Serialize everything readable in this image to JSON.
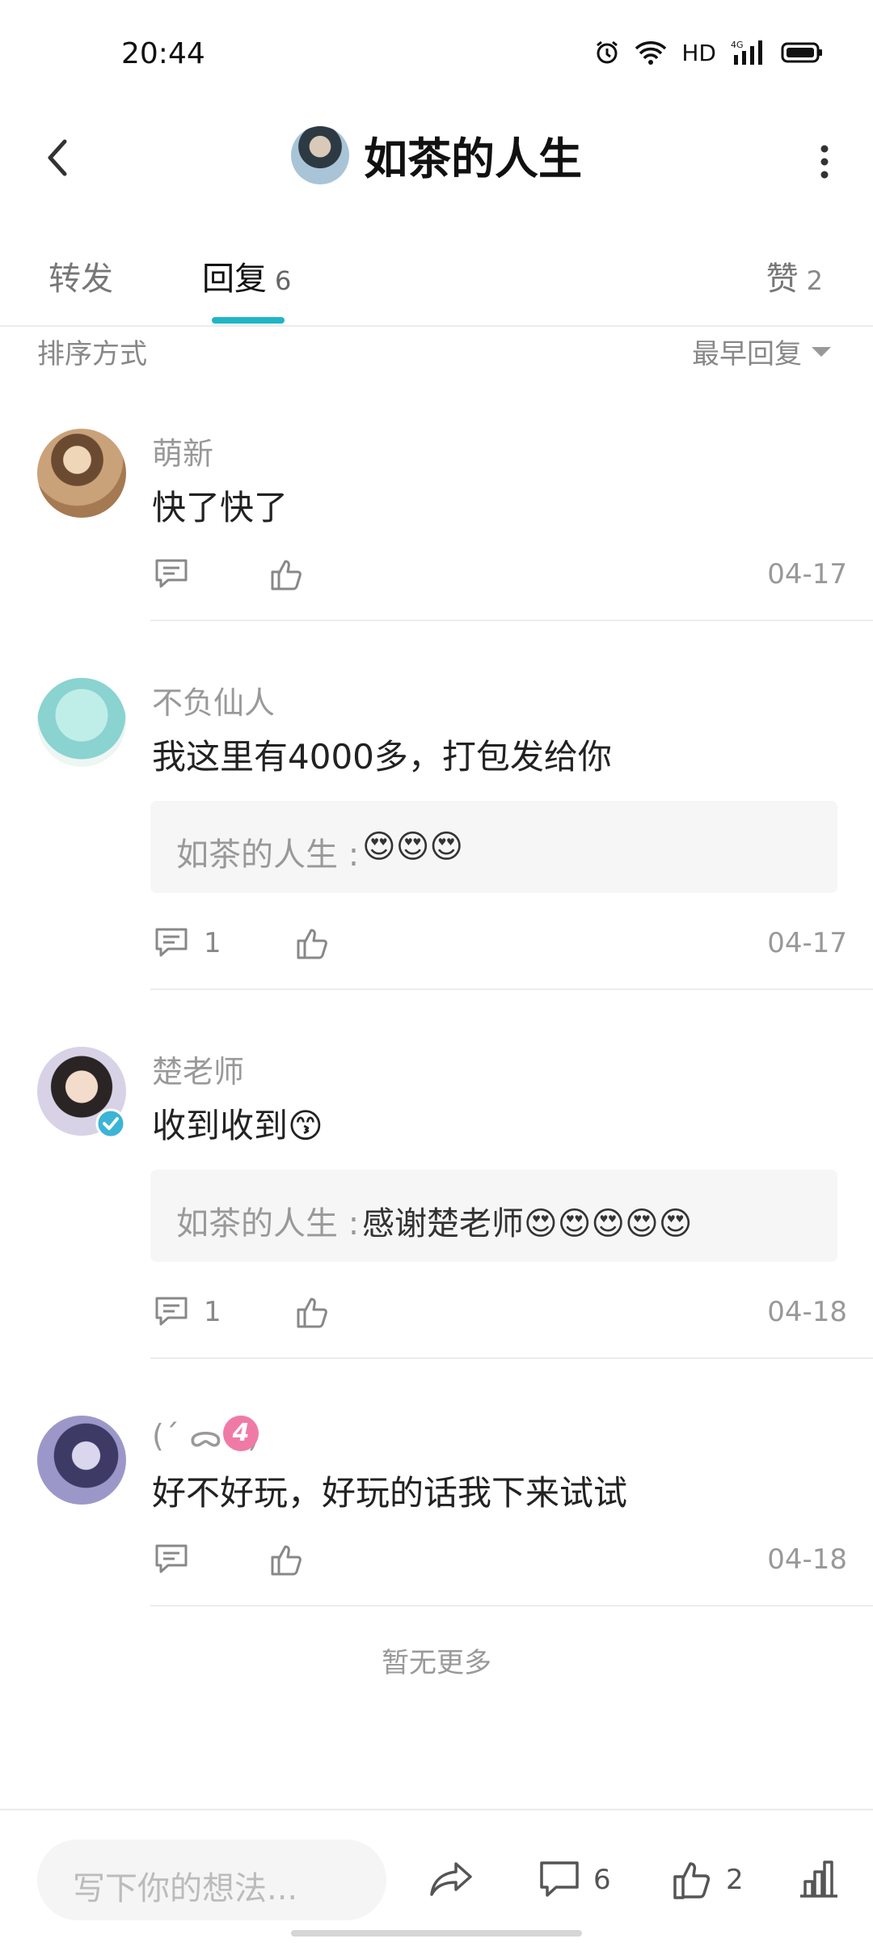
{
  "status_bar": {
    "time": "20:44",
    "network": "HD",
    "signal_label": "4G"
  },
  "nav": {
    "title": "如茶的人生",
    "back_icon": "chevron-left-icon",
    "more_icon": "more-vertical-icon"
  },
  "tabs": {
    "forward_label": "转发",
    "reply_label": "回复",
    "reply_count": "6",
    "like_label": "赞",
    "like_count": "2",
    "active": "回复",
    "accent_color": "#1fb5c5"
  },
  "sort": {
    "label": "排序方式",
    "selected": "最早回复"
  },
  "comments": [
    {
      "user": "萌新",
      "text": "快了快了",
      "reply_count": "",
      "date": "04-17",
      "quote": null
    },
    {
      "user": "不负仙人",
      "text": "我这里有4000多，打包发给你",
      "reply_count": "1",
      "date": "04-17",
      "quote": {
        "name": "如茶的人生 : ",
        "text": "😍😍😍"
      }
    },
    {
      "user": "楚老师",
      "text": "收到收到😙",
      "reply_count": "1",
      "date": "04-18",
      "quote": {
        "name": "如茶的人生 : ",
        "text": "感谢楚老师😍😍😍😍😍"
      }
    },
    {
      "user": "(ˊ ᯅ ˋ)",
      "level": "4",
      "text": "好不好玩，好玩的话我下来试试",
      "reply_count": "",
      "date": "04-18",
      "quote": null
    }
  ],
  "no_more": "暂无更多",
  "bottom_bar": {
    "input_placeholder": "写下你的想法...",
    "comment_count": "6",
    "like_count": "2"
  }
}
